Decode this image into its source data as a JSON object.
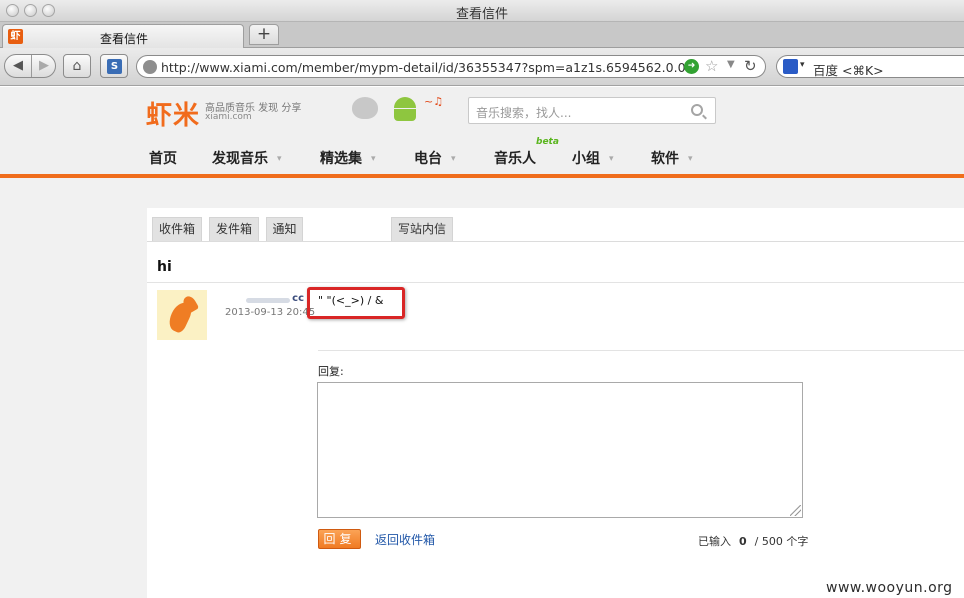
{
  "window": {
    "title": "查看信件"
  },
  "tab": {
    "favicon_text": "虾",
    "title": "查看信件",
    "new_tab_symbol": "+"
  },
  "navbar": {
    "url": "http://www.xiami.com/member/mypm-detail/id/36355347?spm=a1z1s.6594562.0.0.v",
    "search_engine": "百度 <⌘K>",
    "s_ext_text": "S"
  },
  "site": {
    "logo": "虾米",
    "slogan": "高品质音乐 发现 分享",
    "domain": "xiami.com",
    "music_note": "~♫",
    "search_placeholder": "音乐搜索，找人...",
    "beta": "beta",
    "nav": [
      "首页",
      "发现音乐",
      "精选集",
      "电台",
      "音乐人",
      "小组",
      "软件"
    ],
    "nav_arrow": "▾"
  },
  "mailbox": {
    "tabs": [
      "收件箱",
      "发件箱",
      "通知",
      "写站内信"
    ]
  },
  "message": {
    "subject": "hi",
    "sender_suffix": "cc",
    "time": "2013-09-13 20:45",
    "body": "\" \"(<_>) / &"
  },
  "reply": {
    "label": "回复:",
    "button": "回复",
    "back_link": "返回收件箱",
    "counter_prefix": "已输入",
    "counter_value": "0",
    "counter_suffix": "/ 500 个字"
  },
  "watermark": "www.wooyun.org",
  "colors": {
    "brand_orange": "#f06d1c",
    "highlight_red": "#d92626",
    "link_blue": "#2157a8"
  }
}
